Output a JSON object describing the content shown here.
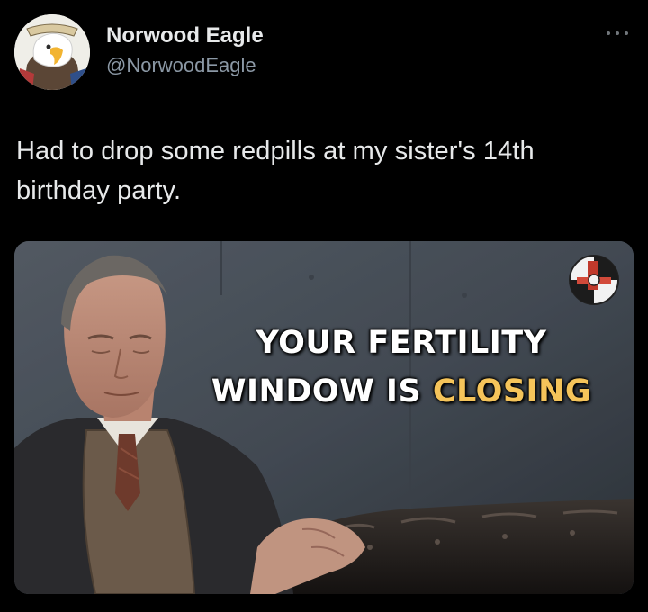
{
  "user": {
    "display_name": "Norwood Eagle",
    "handle": "@NorwoodEagle",
    "avatar_icon": "eagle-avatar-icon"
  },
  "tweet": {
    "text": "Had to drop some redpills at my sister's 14th birthday party."
  },
  "media": {
    "caption_line1": "YOUR FERTILITY",
    "caption_line2_a": "WINDOW IS",
    "caption_line2_b": "CLOSING",
    "caption_highlight_color": "#f5c45a"
  },
  "menu": {
    "icon": "more-options-icon"
  }
}
